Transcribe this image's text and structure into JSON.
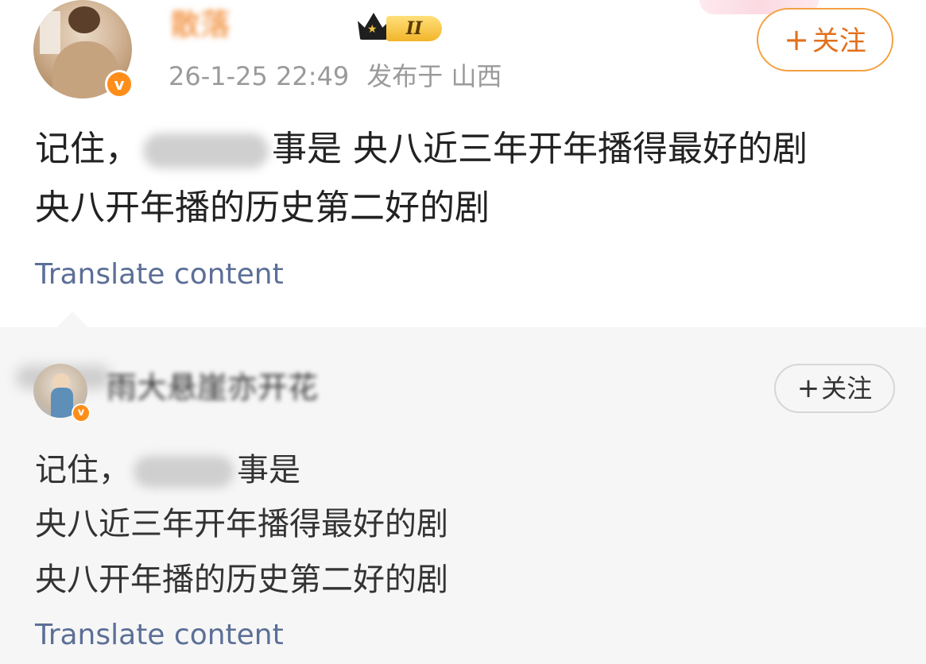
{
  "post": {
    "username": "散落",
    "member_rank": "II",
    "date": "26-1-25 22:49",
    "location": "发布于 山西",
    "follow_label": "关注",
    "content_prefix": "记住，",
    "content_line1_suffix": "事是 央八近三年开年播得最好的剧",
    "content_line2": "央八开年播的历史第二好的剧",
    "translate_label": "Translate content"
  },
  "repost": {
    "username": "雨大悬崖亦开花",
    "follow_label": "关注",
    "line1_prefix": "记住，",
    "line1_suffix": "事是",
    "line2": "央八近三年开年播得最好的剧",
    "line3": "央八开年播的历史第二好的剧",
    "translate_label": "Translate content"
  },
  "colors": {
    "accent_orange": "#ef7c1b",
    "translate_link": "#5b6f97",
    "verified_badge": "#ff8d1a"
  },
  "icons": {
    "crown": "crown-icon",
    "verified": "verified-badge-icon",
    "plus": "plus-icon"
  }
}
